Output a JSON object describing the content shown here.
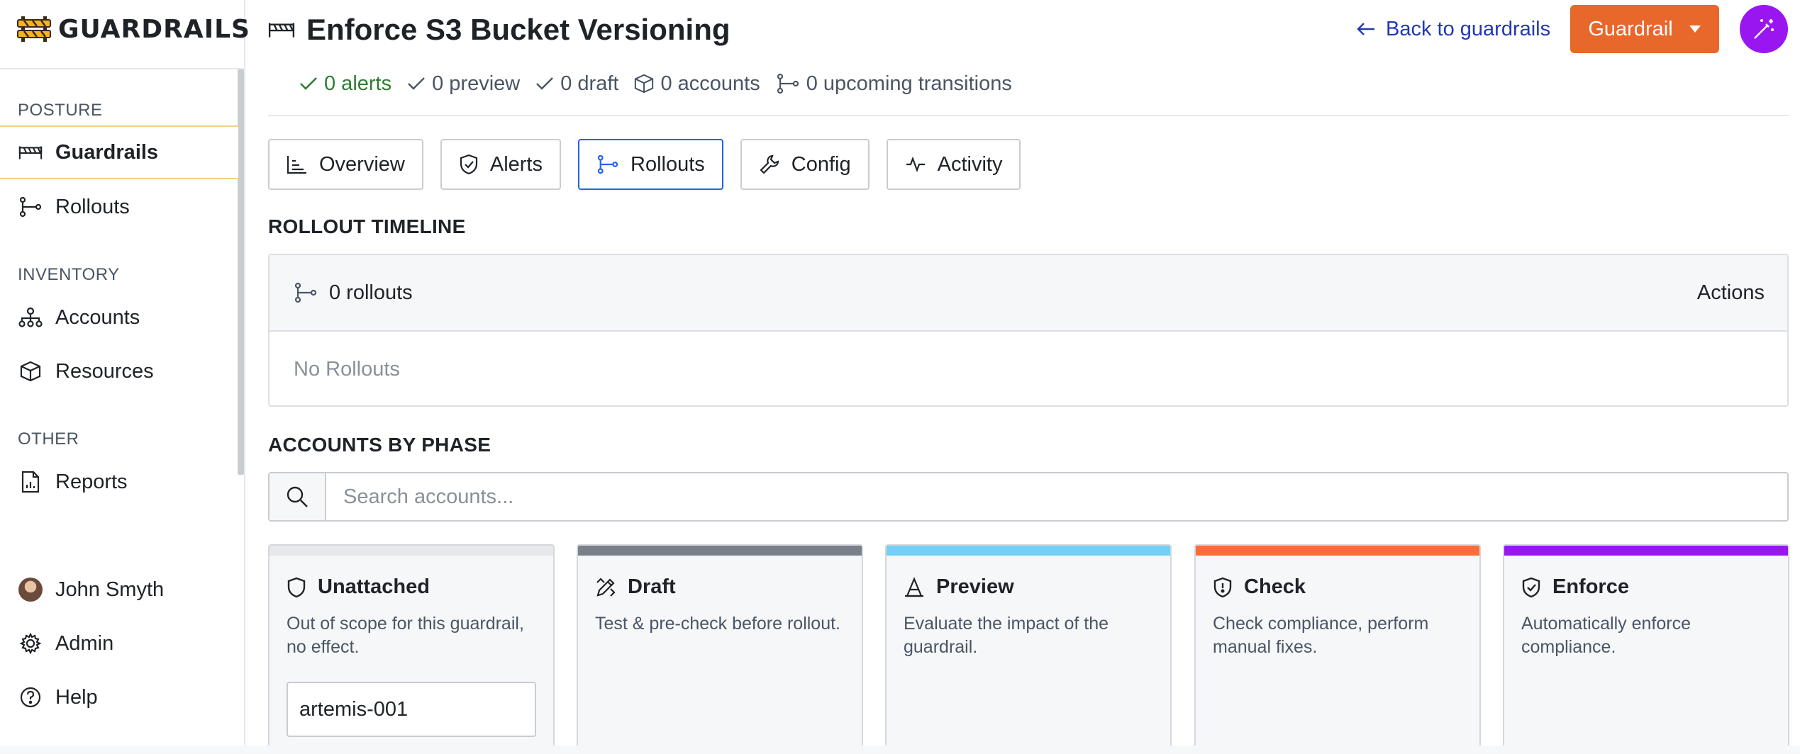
{
  "app": {
    "name": "GUARDRAILS"
  },
  "sidebar": {
    "sections": [
      {
        "label": "POSTURE",
        "items": [
          {
            "label": "Guardrails",
            "icon": "barrier-icon",
            "active": true
          },
          {
            "label": "Rollouts",
            "icon": "rollout-icon"
          }
        ]
      },
      {
        "label": "INVENTORY",
        "items": [
          {
            "label": "Accounts",
            "icon": "hierarchy-icon"
          },
          {
            "label": "Resources",
            "icon": "cube-icon"
          }
        ]
      },
      {
        "label": "OTHER",
        "items": [
          {
            "label": "Reports",
            "icon": "report-icon"
          }
        ]
      }
    ],
    "footer": [
      {
        "label": "John Smyth",
        "icon": "avatar"
      },
      {
        "label": "Admin",
        "icon": "gear-icon"
      },
      {
        "label": "Help",
        "icon": "help-icon"
      }
    ]
  },
  "header": {
    "title": "Enforce S3 Bucket Versioning",
    "back_link": "Back to guardrails",
    "action_button": "Guardrail",
    "stats": {
      "alerts": "0 alerts",
      "preview": "0 preview",
      "draft": "0 draft",
      "accounts": "0 accounts",
      "transitions": "0 upcoming transitions"
    }
  },
  "tabs": [
    {
      "label": "Overview",
      "icon": "chart-icon"
    },
    {
      "label": "Alerts",
      "icon": "shield-check-icon"
    },
    {
      "label": "Rollouts",
      "icon": "rollout-icon",
      "active": true
    },
    {
      "label": "Config",
      "icon": "wrench-icon"
    },
    {
      "label": "Activity",
      "icon": "pulse-icon"
    }
  ],
  "rollout_timeline": {
    "heading": "ROLLOUT TIMELINE",
    "count": "0 rollouts",
    "actions": "Actions",
    "empty": "No Rollouts"
  },
  "accounts_by_phase": {
    "heading": "ACCOUNTS BY PHASE",
    "search_placeholder": "Search accounts...",
    "phases": [
      {
        "title": "Unattached",
        "description": "Out of scope for this guardrail, no effect.",
        "color": "#e6e8eb",
        "accounts": [
          "artemis-001"
        ]
      },
      {
        "title": "Draft",
        "description": "Test & pre-check before rollout.",
        "color": "#7a8089",
        "accounts": []
      },
      {
        "title": "Preview",
        "description": "Evaluate the impact of the guardrail.",
        "color": "#72cff5",
        "accounts": []
      },
      {
        "title": "Check",
        "description": "Check compliance, perform manual fixes.",
        "color": "#fb6c36",
        "accounts": []
      },
      {
        "title": "Enforce",
        "description": "Automatically enforce compliance.",
        "color": "#9a16f0",
        "accounts": []
      }
    ]
  },
  "colors": {
    "accent": "#e8672a",
    "link": "#2138b5",
    "magic": "#9a16f0",
    "active_tab": "#2563eb"
  }
}
